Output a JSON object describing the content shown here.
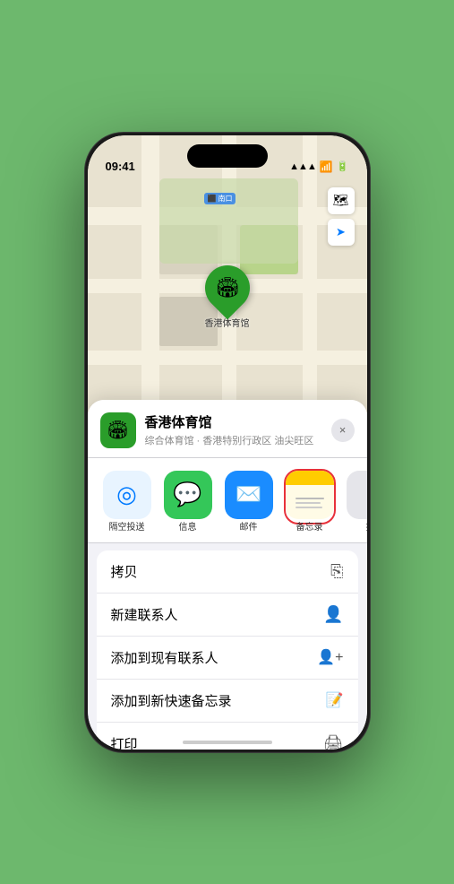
{
  "status_bar": {
    "time": "09:41",
    "signal": "●●●●",
    "wifi": "wifi",
    "battery": "battery"
  },
  "map": {
    "label": "南口",
    "controls": {
      "map_icon": "🗺",
      "location_icon": "➤"
    }
  },
  "venue": {
    "name": "香港体育馆",
    "subtitle": "综合体育馆 · 香港特别行政区 油尖旺区",
    "icon": "🏟"
  },
  "apps": [
    {
      "id": "airdrop",
      "label": "隔空投送"
    },
    {
      "id": "messages",
      "label": "信息",
      "emoji": "💬"
    },
    {
      "id": "mail",
      "label": "邮件",
      "emoji": "✉️"
    },
    {
      "id": "notes",
      "label": "备忘录",
      "selected": true
    },
    {
      "id": "more",
      "label": "推"
    }
  ],
  "actions": [
    {
      "label": "拷贝",
      "icon": "copy"
    },
    {
      "label": "新建联系人",
      "icon": "person"
    },
    {
      "label": "添加到现有联系人",
      "icon": "person-add"
    },
    {
      "label": "添加到新快速备忘录",
      "icon": "note"
    },
    {
      "label": "打印",
      "icon": "print"
    }
  ],
  "close_label": "×",
  "pin_label": "香港体育馆"
}
